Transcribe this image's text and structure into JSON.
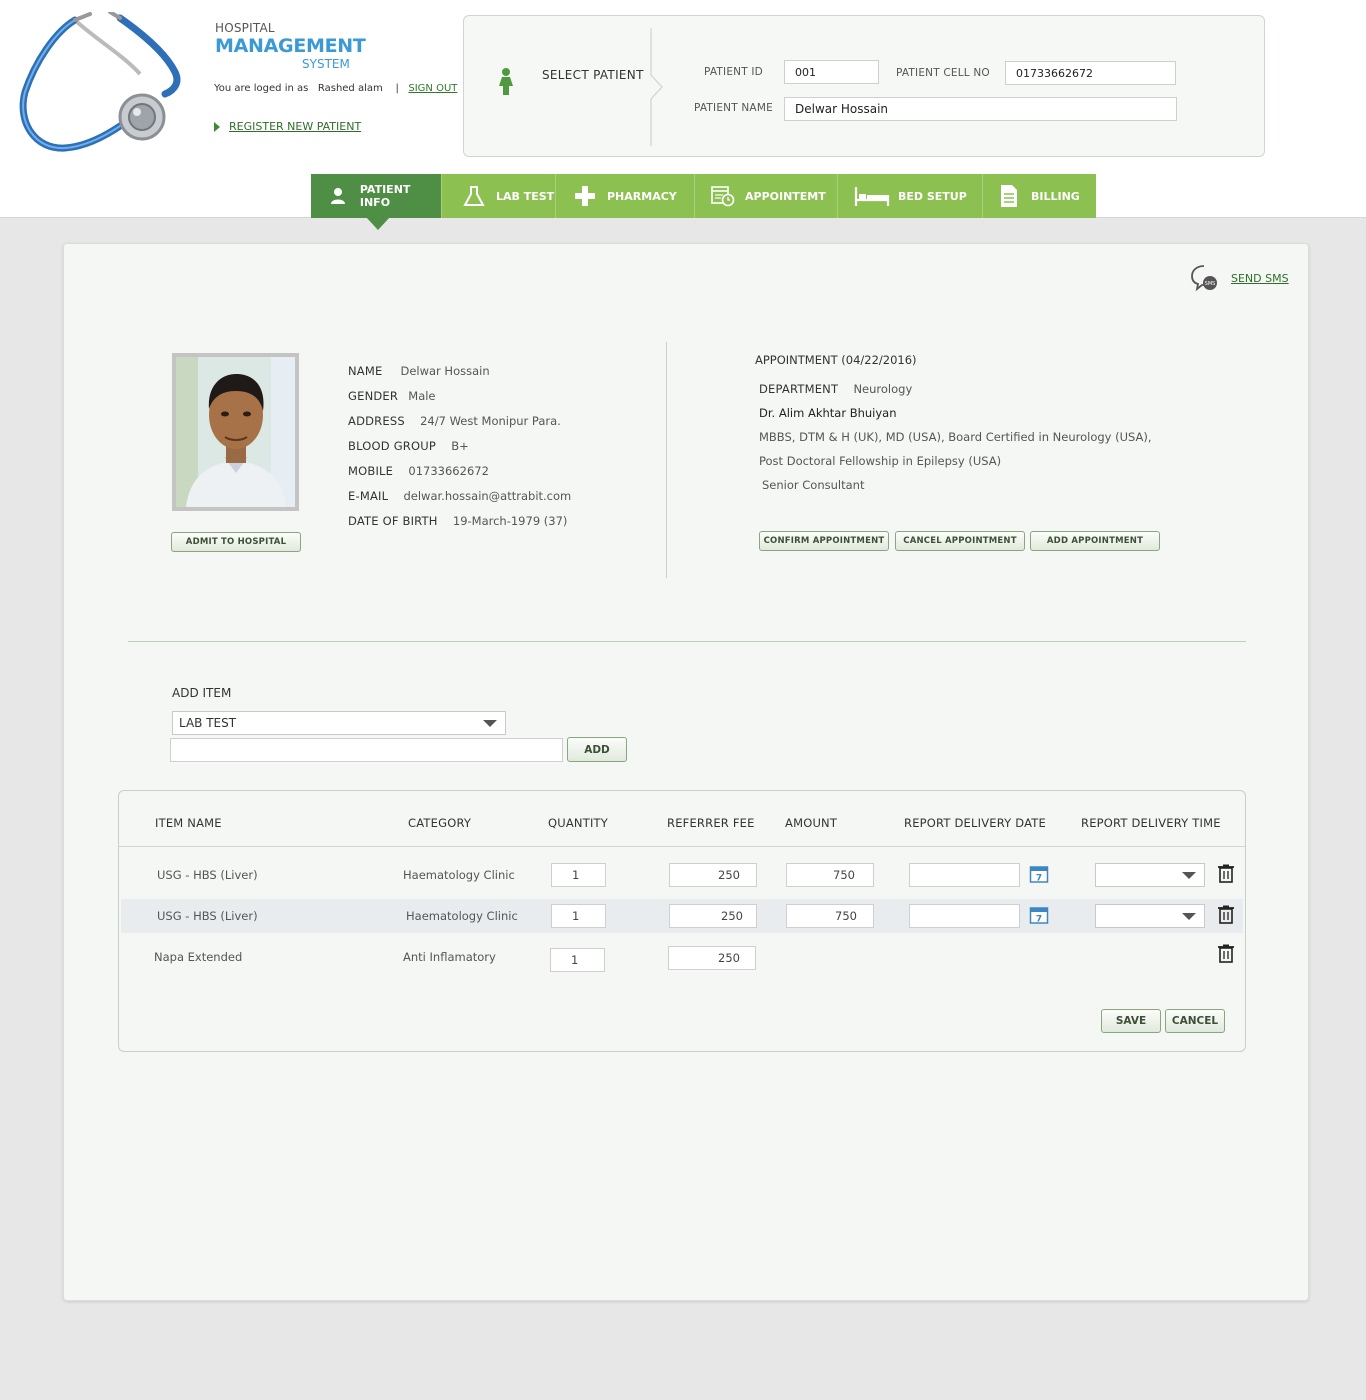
{
  "logo": {
    "line1": "HOSPITAL",
    "line2": "MANAGEMENT",
    "line3": "SYSTEM"
  },
  "session": {
    "logged_in_text": "You are loged in as",
    "user": "Rashed alam",
    "separator": "|",
    "sign_out": "SIGN OUT"
  },
  "register_link": "REGISTER NEW PATIENT",
  "select_patient": {
    "title": "SELECT PATIENT",
    "patient_id_label": "PATIENT ID",
    "patient_id": "001",
    "cell_label": "PATIENT CELL NO",
    "cell": "01733662672",
    "name_label": "PATIENT NAME",
    "name": "Delwar Hossain"
  },
  "tabs": [
    {
      "label": "PATIENT INFO",
      "icon": "person-icon",
      "active": true
    },
    {
      "label": "LAB TEST",
      "icon": "flask-icon",
      "active": false
    },
    {
      "label": "PHARMACY",
      "icon": "medical-cross-icon",
      "active": false
    },
    {
      "label": "APPOINTEMT",
      "icon": "calendar-clock-icon",
      "active": false
    },
    {
      "label": "BED SETUP",
      "icon": "bed-icon",
      "active": false
    },
    {
      "label": "BILLING",
      "icon": "document-icon",
      "active": false
    }
  ],
  "send_sms": "SEND SMS",
  "patient": {
    "name_label": "NAME",
    "name": "Delwar Hossain",
    "gender_label": "GENDER",
    "gender": "Male",
    "address_label": "ADDRESS",
    "address": "24/7  West Monipur Para.",
    "blood_label": "BLOOD GROUP",
    "blood": "B+",
    "mobile_label": "MOBILE",
    "mobile": "01733662672",
    "email_label": "E-MAIL",
    "email": "delwar.hossain@attrabit.com",
    "dob_label": "DATE OF BIRTH",
    "dob": "19-March-1979  (37)",
    "admit_button": "ADMIT TO HOSPITAL"
  },
  "appointment": {
    "title": "APPOINTMENT (04/22/2016)",
    "department_label": "DEPARTMENT",
    "department": "Neurology",
    "doctor": "Dr. Alim Akhtar Bhuiyan",
    "qualification_1": "MBBS, DTM & H (UK), MD (USA), Board Certified in Neurology (USA),",
    "qualification_2": "Post Doctoral Fellowship in Epilepsy (USA)",
    "position": "Senior Consultant",
    "confirm_button": "CONFIRM APPOINTMENT",
    "cancel_button": "CANCEL APPOINTMENT",
    "add_button": "ADD APPOINTMENT"
  },
  "add_item": {
    "title": "ADD ITEM",
    "type_selected": "LAB TEST",
    "search_value": "",
    "add_button": "ADD"
  },
  "items_table": {
    "headers": [
      "ITEM  NAME",
      "CATEGORY",
      "QUANTITY",
      "REFERRER  FEE",
      "AMOUNT",
      "REPORT DELIVERY DATE",
      "REPORT DELIVERY TIME"
    ],
    "rows": [
      {
        "item": "USG - HBS (Liver)",
        "category": "Haematology Clinic",
        "quantity": "1",
        "fee": "250",
        "amount": "750"
      },
      {
        "item": "USG - HBS (Liver)",
        "category": "Haematology Clinic",
        "quantity": "1",
        "fee": "250",
        "amount": "750"
      },
      {
        "item": "Napa Extended",
        "category": "Anti Inflamatory",
        "quantity": "1",
        "fee": "250"
      }
    ],
    "save_button": "SAVE",
    "cancel_button": "CANCEL"
  },
  "colors": {
    "tab_green": "#8cc152",
    "tab_active": "#4f8f45",
    "logo_blue": "#3b9ad6",
    "link_green": "#2f7a2a"
  }
}
